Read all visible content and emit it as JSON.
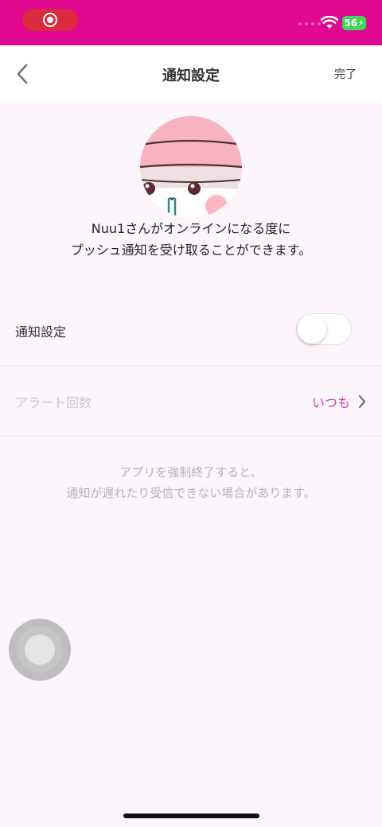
{
  "status_bar": {
    "battery": "56",
    "icons": [
      "record-icon",
      "wifi-icon",
      "battery-charging-icon"
    ],
    "color": "#e0088f"
  },
  "nav": {
    "title": "通知設定",
    "done_label": "完了",
    "back_icon": "chevron-left-icon"
  },
  "profile": {
    "line1": "Nuu1さんがオンラインになる度に",
    "line2": "プッシュ通知を受け取ることができます。"
  },
  "settings": {
    "notify_label": "通知設定",
    "notify_enabled": false,
    "alert_label": "アラート回数",
    "alert_value": "いつも"
  },
  "note": {
    "line1": "アプリを強制終了すると、",
    "line2": "通知が遅れたり受信できない場合があります。"
  },
  "colors": {
    "accent": "#d63bb0",
    "background": "#fcf6fc"
  }
}
